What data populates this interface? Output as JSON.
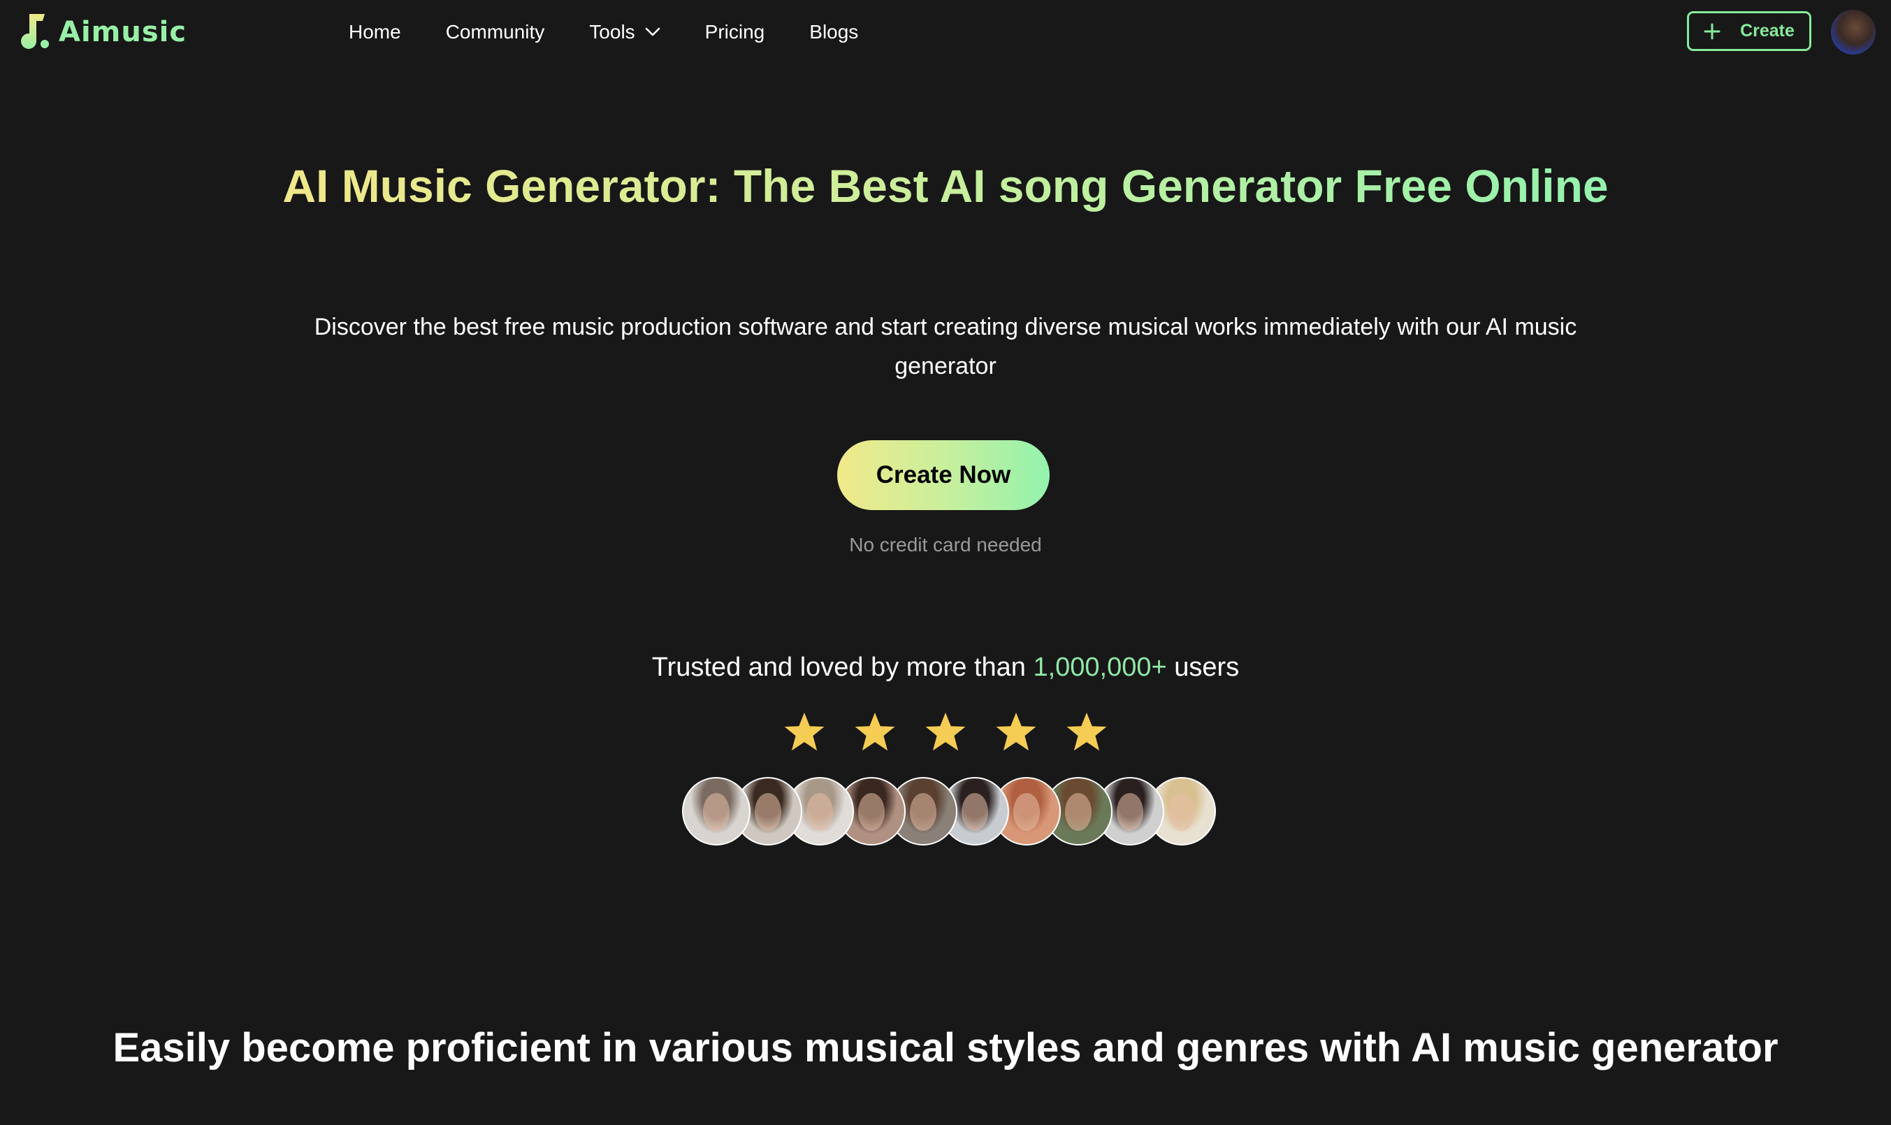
{
  "nav": {
    "logo_text": "Aimusic",
    "links": [
      {
        "label": "Home"
      },
      {
        "label": "Community"
      },
      {
        "label": "Tools",
        "has_dropdown": true
      },
      {
        "label": "Pricing"
      },
      {
        "label": "Blogs"
      }
    ],
    "create_button": "Create",
    "avatar_icon": "user-avatar"
  },
  "hero": {
    "title": "AI Music Generator: The Best AI song Generator Free Online",
    "subtitle": "Discover the best free music production software and start creating diverse musical works immediately with our AI music generator",
    "cta_label": "Create Now",
    "cta_note": "No credit card needed"
  },
  "trust": {
    "prefix": "Trusted and loved by more than ",
    "highlight": "1,000,000+",
    "suffix": " users",
    "rating": 5,
    "rating_max": 5,
    "user_avatars": [
      {
        "name": "user-avatar-1"
      },
      {
        "name": "user-avatar-2"
      },
      {
        "name": "user-avatar-3"
      },
      {
        "name": "user-avatar-4"
      },
      {
        "name": "user-avatar-5"
      },
      {
        "name": "user-avatar-6"
      },
      {
        "name": "user-avatar-7"
      },
      {
        "name": "user-avatar-8"
      },
      {
        "name": "user-avatar-9"
      },
      {
        "name": "user-avatar-10"
      }
    ]
  },
  "section": {
    "title": "Easily become proficient in various musical styles and genres with AI music generator"
  },
  "colors": {
    "background": "#181818",
    "accent_green": "#86ea9a",
    "gradient_start": "#f0e88a",
    "gradient_end": "#94f2ae",
    "star": "#f5cd54",
    "muted_text": "#9a9a9a"
  }
}
